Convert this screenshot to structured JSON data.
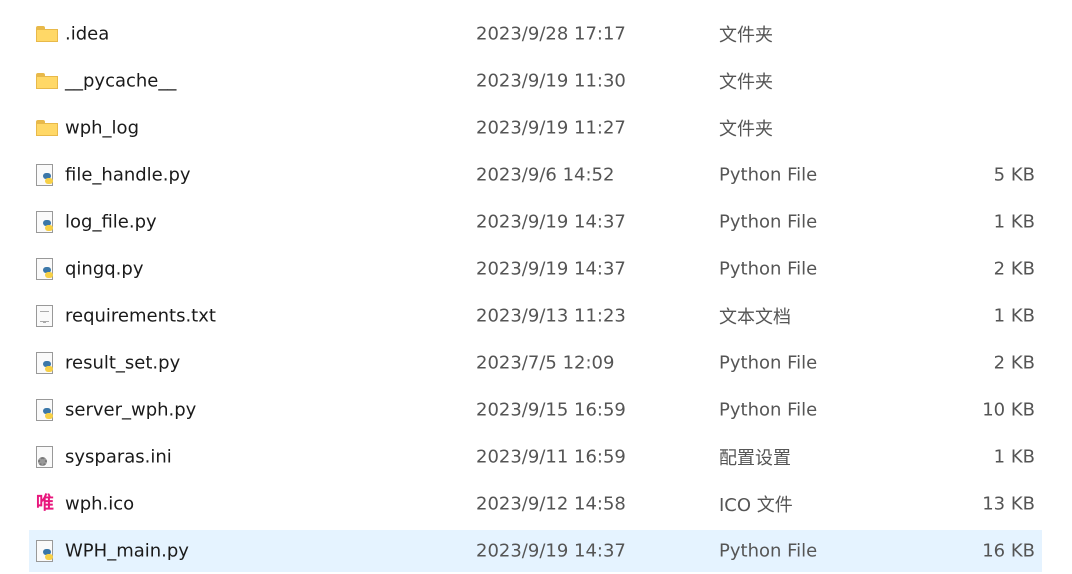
{
  "files": [
    {
      "name": ".idea",
      "date": "2023/9/28 17:17",
      "type": "文件夹",
      "size": "",
      "icon": "folder-icon"
    },
    {
      "name": "__pycache__",
      "date": "2023/9/19 11:30",
      "type": "文件夹",
      "size": "",
      "icon": "folder-icon"
    },
    {
      "name": "wph_log",
      "date": "2023/9/19 11:27",
      "type": "文件夹",
      "size": "",
      "icon": "folder-icon"
    },
    {
      "name": "file_handle.py",
      "date": "2023/9/6 14:52",
      "type": "Python File",
      "size": "5 KB",
      "icon": "python-file-icon"
    },
    {
      "name": "log_file.py",
      "date": "2023/9/19 14:37",
      "type": "Python File",
      "size": "1 KB",
      "icon": "python-file-icon"
    },
    {
      "name": "qingq.py",
      "date": "2023/9/19 14:37",
      "type": "Python File",
      "size": "2 KB",
      "icon": "python-file-icon"
    },
    {
      "name": "requirements.txt",
      "date": "2023/9/13 11:23",
      "type": "文本文档",
      "size": "1 KB",
      "icon": "text-file-icon"
    },
    {
      "name": "result_set.py",
      "date": "2023/7/5 12:09",
      "type": "Python File",
      "size": "2 KB",
      "icon": "python-file-icon"
    },
    {
      "name": "server_wph.py",
      "date": "2023/9/15 16:59",
      "type": "Python File",
      "size": "10 KB",
      "icon": "python-file-icon"
    },
    {
      "name": "sysparas.ini",
      "date": "2023/9/11 16:59",
      "type": "配置设置",
      "size": "1 KB",
      "icon": "settings-file-icon"
    },
    {
      "name": "wph.ico",
      "date": "2023/9/12 14:58",
      "type": "ICO 文件",
      "size": "13 KB",
      "icon": "ico-file-icon",
      "glyph": "唯"
    },
    {
      "name": "WPH_main.py",
      "date": "2023/9/19 14:37",
      "type": "Python File",
      "size": "16 KB",
      "icon": "python-file-icon",
      "selected": true
    }
  ],
  "colors": {
    "selection": "#e5f3ff",
    "ico_glyph": "#e8177d"
  }
}
